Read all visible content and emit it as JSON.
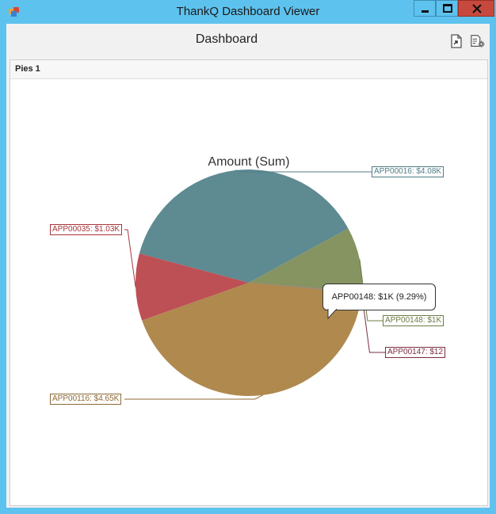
{
  "window": {
    "title": "ThankQ Dashboard Viewer",
    "icons": {
      "app": "app-windows-icon",
      "minimize": "minimize-icon",
      "maximize": "maximize-icon",
      "close": "close-icon"
    }
  },
  "header": {
    "title": "Dashboard",
    "icons": {
      "export": "export-document-icon",
      "parameters": "parameters-settings-icon"
    }
  },
  "panel": {
    "caption": "Pies 1"
  },
  "chart_data": {
    "type": "pie",
    "title": "Amount (Sum)",
    "slices": [
      {
        "name": "APP00016",
        "value": 4080,
        "label": "APP00016: $4.08K",
        "color": "#5e8a92"
      },
      {
        "name": "APP00148",
        "value": 1000,
        "label": "APP00148: $1K",
        "color": "#859461"
      },
      {
        "name": "APP00147",
        "value": 12,
        "label": "APP00147: $12",
        "color": "#9c8c88"
      },
      {
        "name": "APP00116",
        "value": 4650,
        "label": "APP00116: $4.65K",
        "color": "#b0894f"
      },
      {
        "name": "APP00035",
        "value": 1030,
        "label": "APP00035: $1.03K",
        "color": "#bd5055"
      }
    ],
    "label_colors": {
      "APP00016": "#4f7c85",
      "APP00148": "#6b7c45",
      "APP00147": "#7a2d3f",
      "APP00116": "#8d6a36",
      "APP00035": "#a8363b"
    },
    "tooltip": "APP00148: $1K (9.29%)"
  }
}
